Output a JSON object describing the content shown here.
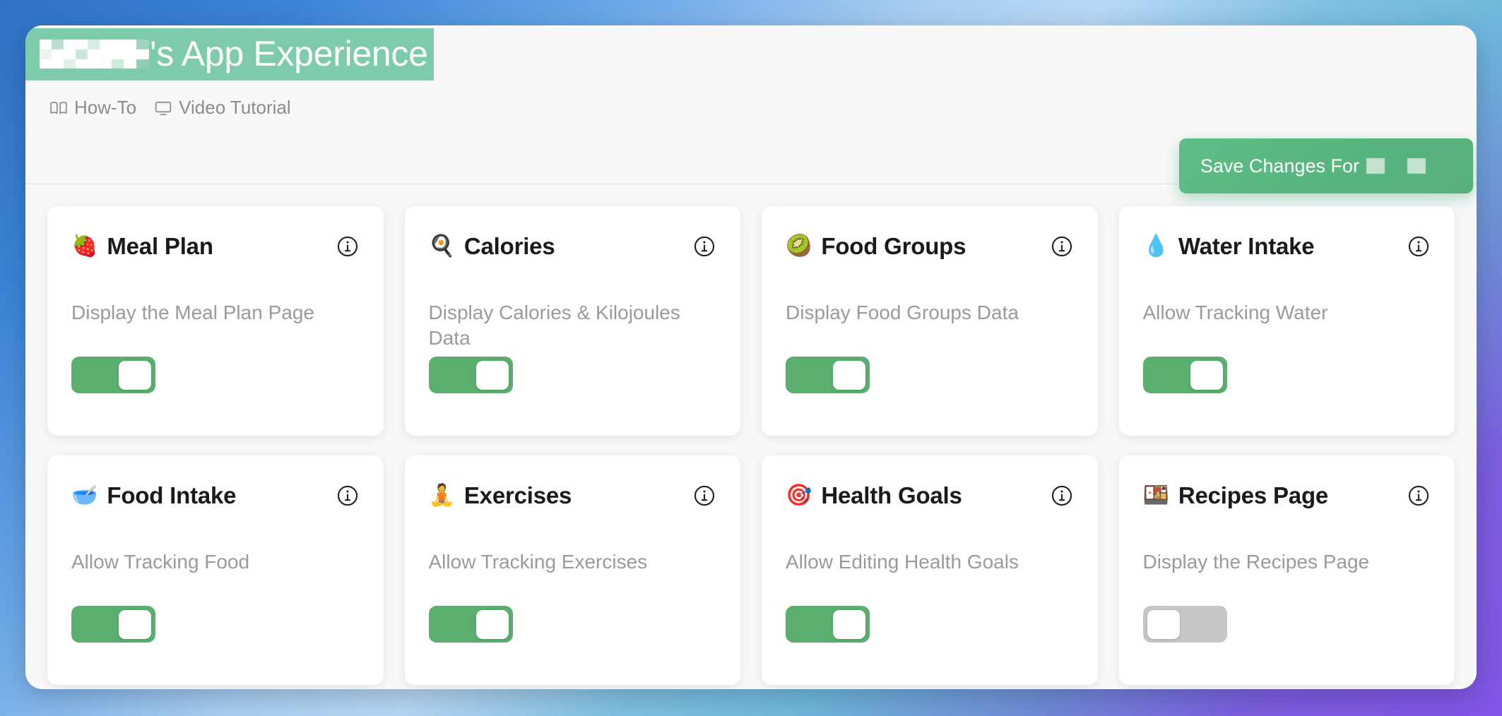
{
  "header": {
    "title_redacted_name": "[REDACTED]",
    "title_suffix": "'s App Experience",
    "title_highlight_color": "#7ecbab",
    "nav": [
      {
        "label": "How-To",
        "icon": "open-book-icon"
      },
      {
        "label": "Video Tutorial",
        "icon": "monitor-icon"
      }
    ],
    "save_button": {
      "label": "Save Changes For",
      "redacted_name": "[REDACTED]",
      "color": "#57b57e"
    }
  },
  "theme": {
    "toggle_on_color": "#5aaf6e",
    "toggle_off_color": "#c6c6c6",
    "card_background": "#ffffff",
    "panel_background": "#f8f8f8",
    "title_text_color": "#1a1a1a",
    "description_text_color": "#9a9a9a"
  },
  "cards": [
    {
      "emoji": "🍓",
      "icon_name": "strawberry-emoji",
      "title": "Meal Plan",
      "description": "Display the Meal Plan Page",
      "enabled": true,
      "info_label": "info-icon"
    },
    {
      "emoji": "🍳",
      "icon_name": "fried-egg-emoji",
      "title": "Calories",
      "description": "Display Calories & Kilojoules Data",
      "enabled": true,
      "info_label": "info-icon"
    },
    {
      "emoji": "🥝",
      "icon_name": "kiwi-fruit-emoji",
      "title": "Food Groups",
      "description": "Display Food Groups Data",
      "enabled": true,
      "info_label": "info-icon"
    },
    {
      "emoji": "💧",
      "icon_name": "water-droplet-emoji",
      "title": "Water Intake",
      "description": "Allow Tracking Water",
      "enabled": true,
      "info_label": "info-icon"
    },
    {
      "emoji": "🥣",
      "icon_name": "bowl-with-spoon-emoji",
      "title": "Food Intake",
      "description": "Allow Tracking Food",
      "enabled": true,
      "info_label": "info-icon"
    },
    {
      "emoji": "🧘",
      "icon_name": "person-lotus-position-emoji",
      "title": "Exercises",
      "description": "Allow Tracking Exercises",
      "enabled": true,
      "info_label": "info-icon"
    },
    {
      "emoji": "🎯",
      "icon_name": "direct-hit-target-emoji",
      "title": "Health Goals",
      "description": "Allow Editing Health Goals",
      "enabled": true,
      "info_label": "info-icon"
    },
    {
      "emoji": "🍱",
      "icon_name": "bento-box-emoji",
      "title": "Recipes Page",
      "description": "Display the Recipes Page",
      "enabled": false,
      "info_label": "info-icon"
    }
  ]
}
